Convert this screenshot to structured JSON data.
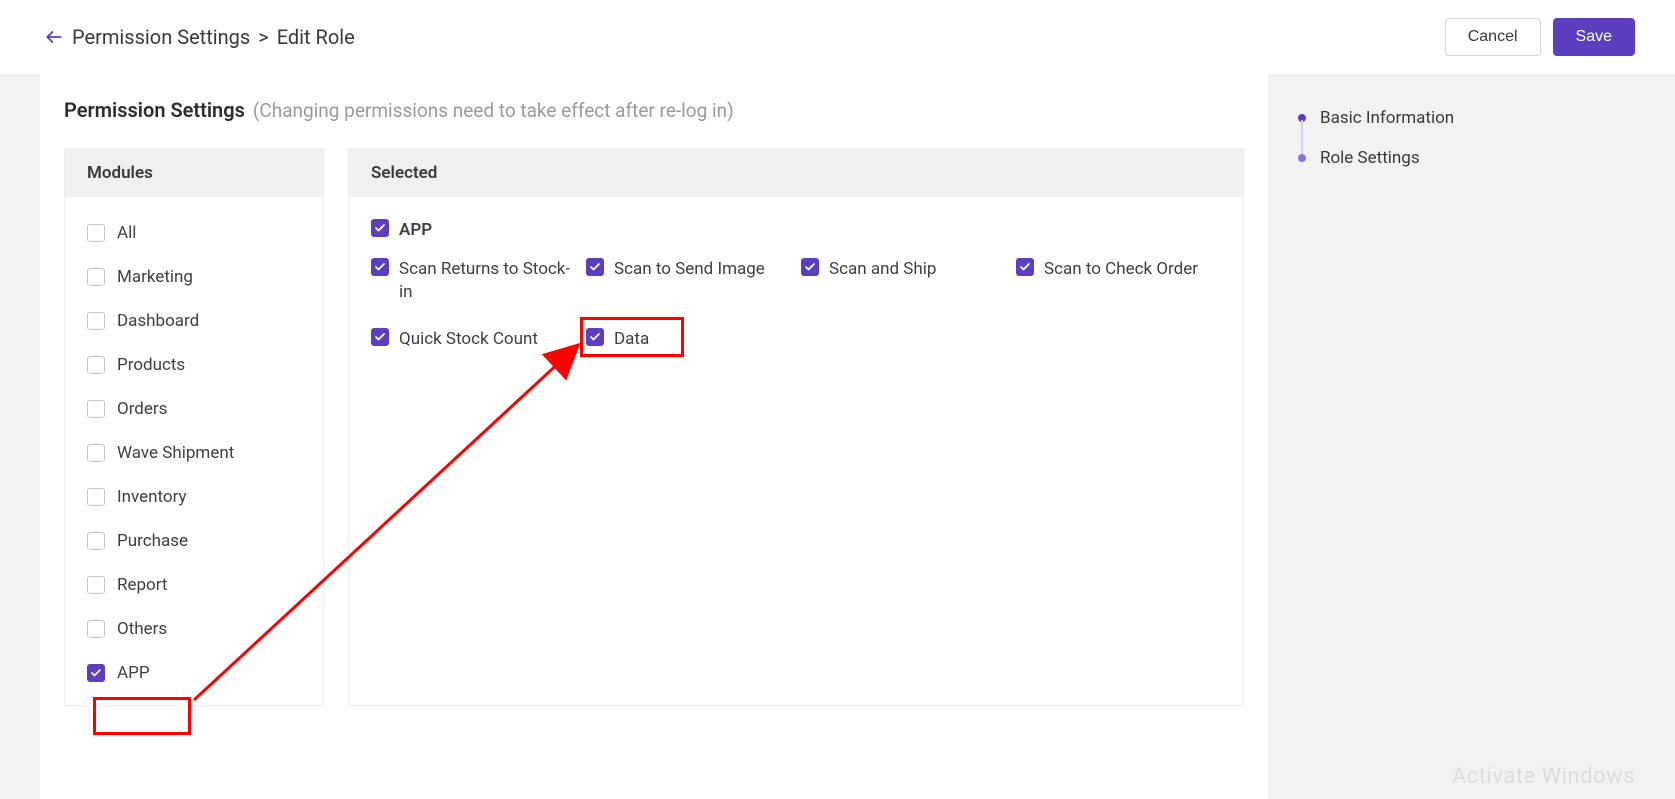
{
  "header": {
    "back_aria": "Back",
    "breadcrumb1": "Permission Settings",
    "separator": ">",
    "breadcrumb2": "Edit Role",
    "cancel_label": "Cancel",
    "save_label": "Save"
  },
  "section": {
    "title": "Permission Settings",
    "subtitle": "(Changing permissions need to take effect after re-log in)"
  },
  "modules_panel": {
    "header": "Modules",
    "items": [
      {
        "label": "All",
        "checked": false
      },
      {
        "label": "Marketing",
        "checked": false
      },
      {
        "label": "Dashboard",
        "checked": false
      },
      {
        "label": "Products",
        "checked": false
      },
      {
        "label": "Orders",
        "checked": false
      },
      {
        "label": "Wave Shipment",
        "checked": false
      },
      {
        "label": "Inventory",
        "checked": false
      },
      {
        "label": "Purchase",
        "checked": false
      },
      {
        "label": "Report",
        "checked": false
      },
      {
        "label": "Others",
        "checked": false
      },
      {
        "label": "APP",
        "checked": true
      }
    ]
  },
  "selected_panel": {
    "header": "Selected",
    "top": {
      "label": "APP",
      "checked": true
    },
    "items": [
      {
        "label": "Scan Returns to Stock-in",
        "checked": true
      },
      {
        "label": "Scan to Send Image",
        "checked": true
      },
      {
        "label": "Scan and Ship",
        "checked": true
      },
      {
        "label": "Scan to Check Order",
        "checked": true
      },
      {
        "label": "Quick Stock Count",
        "checked": true
      },
      {
        "label": "Data",
        "checked": true
      }
    ]
  },
  "side_nav": {
    "items": [
      {
        "label": "Basic Information"
      },
      {
        "label": "Role Settings"
      }
    ]
  },
  "watermark": "Activate Windows"
}
